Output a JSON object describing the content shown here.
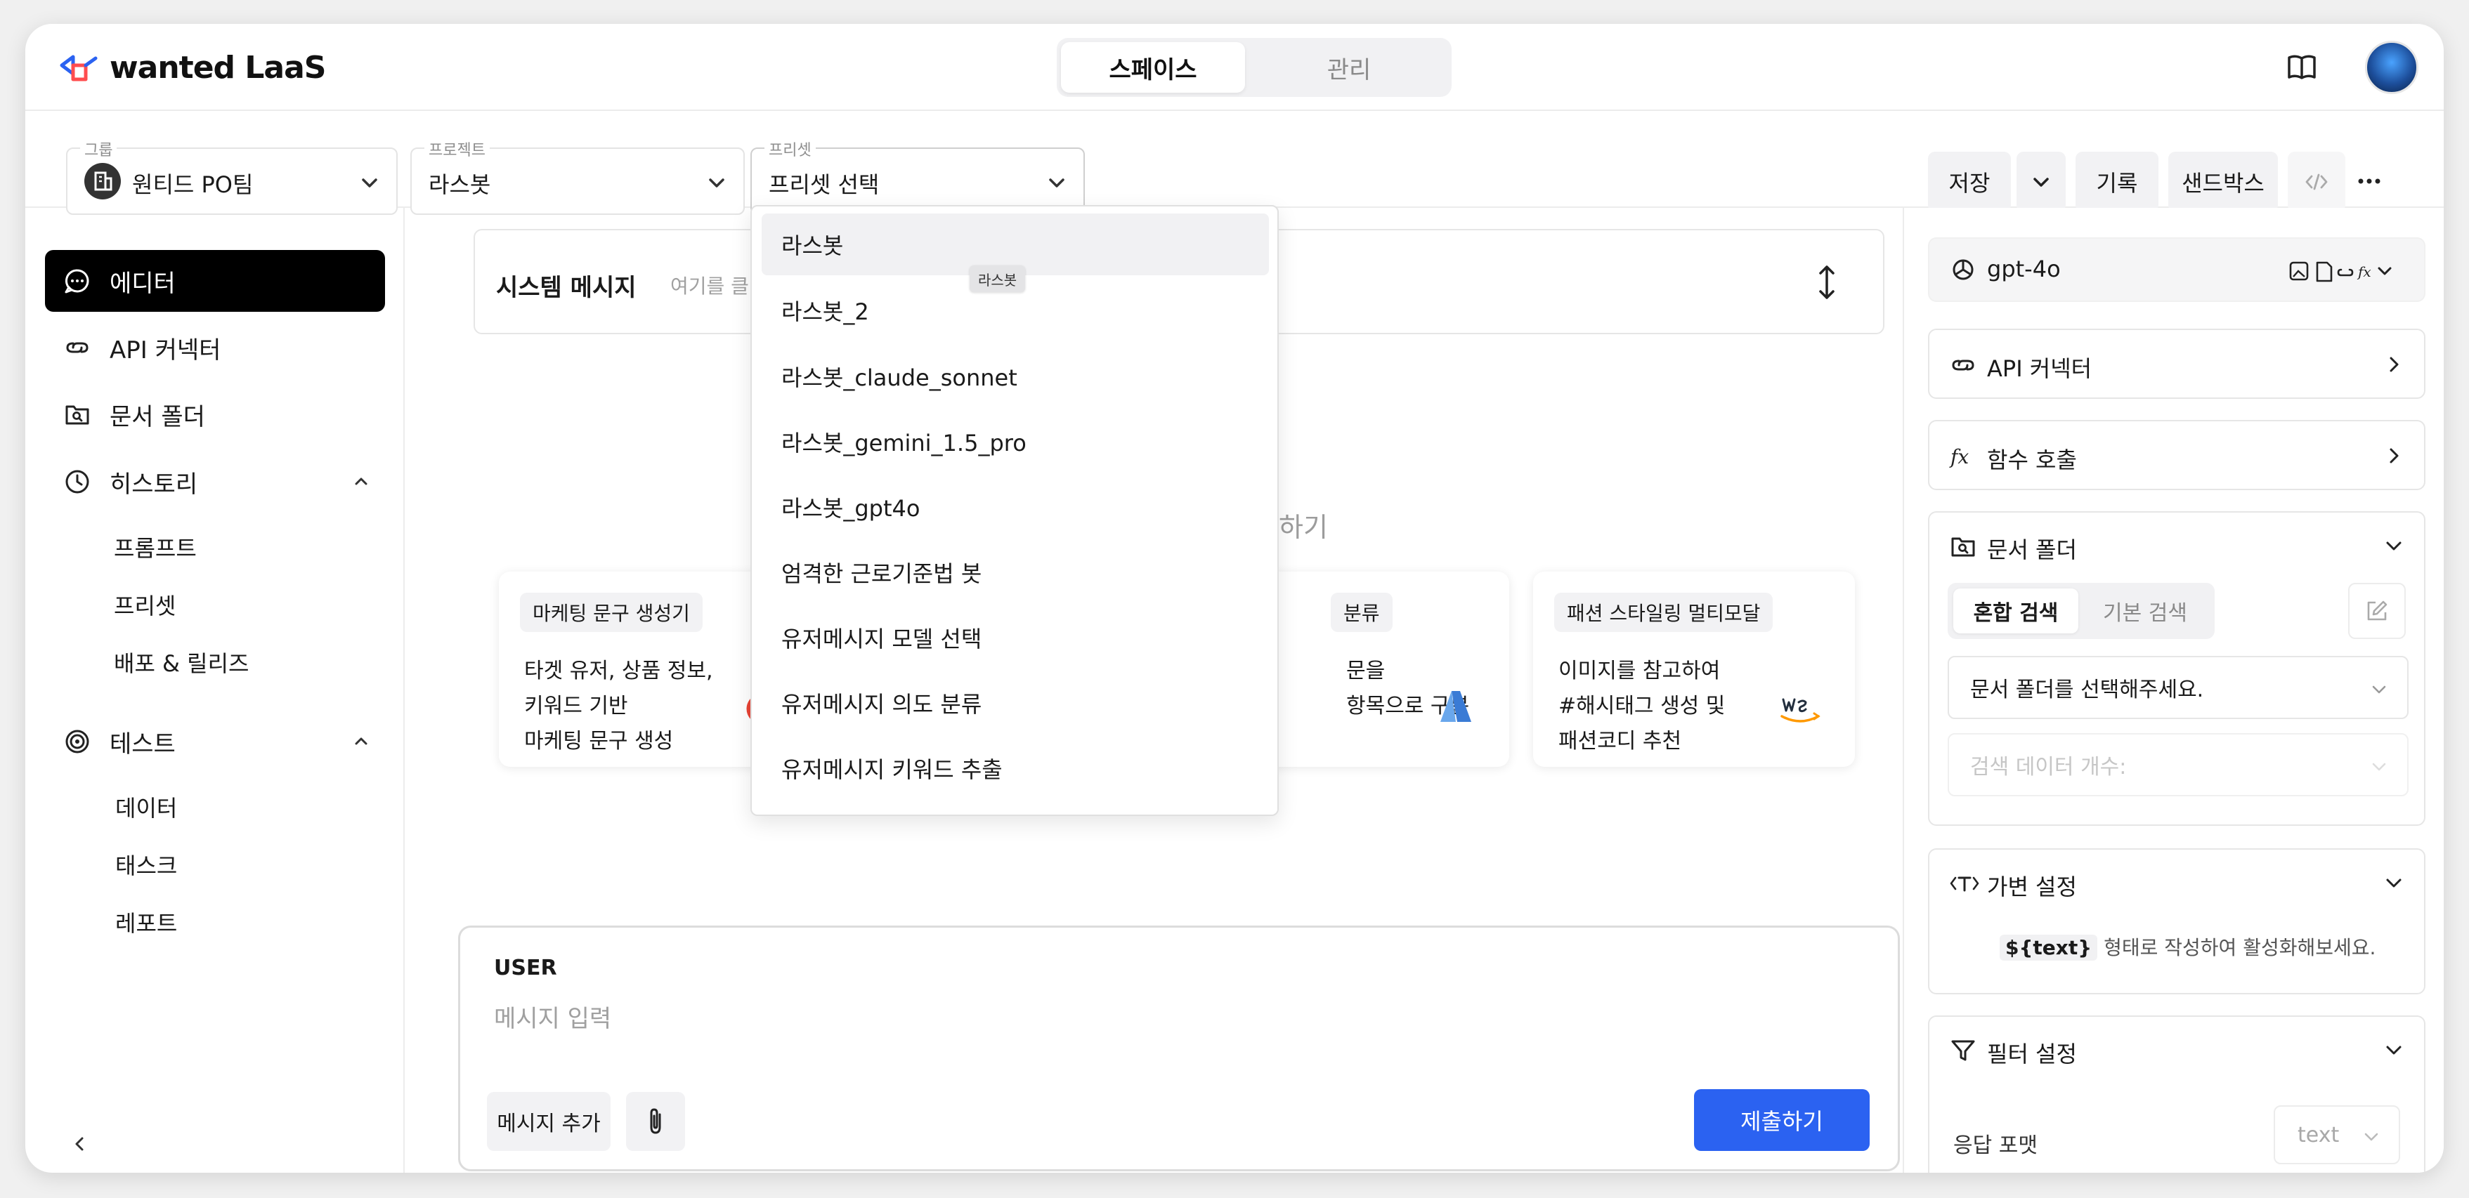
{
  "header": {
    "logo_text": "wanted LaaS",
    "tabs": [
      {
        "label": "스페이스",
        "active": true
      },
      {
        "label": "관리",
        "active": false
      }
    ]
  },
  "toolbar": {
    "group": {
      "label": "그룹",
      "value": "원티드 PO팀"
    },
    "project": {
      "label": "프로젝트",
      "value": "라스봇"
    },
    "preset": {
      "label": "프리셋",
      "value": "프리셋 선택"
    },
    "save_label": "저장",
    "history_label": "기록",
    "sandbox_label": "샌드박스"
  },
  "sidebar": {
    "items": [
      {
        "label": "에디터",
        "icon": "chat-bubble-icon",
        "active": true
      },
      {
        "label": "API 커넥터",
        "icon": "link-icon"
      },
      {
        "label": "문서 폴더",
        "icon": "folder-search-icon"
      },
      {
        "label": "히스토리",
        "icon": "clock-icon",
        "expanded": true
      },
      {
        "label": "테스트",
        "icon": "target-icon",
        "expanded": true
      }
    ],
    "history_sub": [
      "프롬프트",
      "프리셋",
      "배포 & 릴리즈"
    ],
    "test_sub": [
      "데이터",
      "태스크",
      "레포트"
    ]
  },
  "editor": {
    "system_title": "시스템 메시지",
    "system_hint": "여기를 클릭하",
    "center_hint": "하기",
    "cards": [
      {
        "chip": "마케팅 문구 생성기",
        "lines": [
          "타겟 유저, 상품 정보,",
          "키워드 기반",
          "마케팅 문구 생성"
        ]
      },
      {
        "chip": "분류",
        "lines": [
          "문을",
          "항목으로 구분"
        ]
      },
      {
        "chip": "패션 스타일링 멀티모달",
        "lines": [
          "이미지를 참고하여",
          "#해시태그 생성 및",
          "패션코디 추천"
        ]
      }
    ],
    "user_label": "USER",
    "message_placeholder": "메시지 입력",
    "add_message": "메시지 추가",
    "submit": "제출하기"
  },
  "preset_dropdown": {
    "items": [
      "라스봇",
      "라스봇_2",
      "라스봇_claude_sonnet",
      "라스봇_gemini_1.5_pro",
      "라스봇_gpt4o",
      "엄격한 근로기준법 봇",
      "유저메시지 모델 선택",
      "유저메시지 의도 분류",
      "유저메시지 키워드 추출"
    ],
    "hovered_index": 0,
    "tooltip": "라스봇"
  },
  "right_panel": {
    "model": "gpt-4o",
    "api_connector": "API 커넥터",
    "function_call": "함수 호출",
    "doc_folder": {
      "title": "문서 폴더",
      "search_modes": [
        "혼합 검색",
        "기본 검색"
      ],
      "folder_placeholder": "문서 폴더를 선택해주세요.",
      "count_placeholder": "검색 데이터 개수:"
    },
    "variable": {
      "title": "가변 설정",
      "code": "${text}",
      "desc": "형태로 작성하여 활성화해보세요."
    },
    "filter": {
      "title": "필터 설정",
      "response_format_label": "응답 포맷",
      "response_format_value": "text"
    }
  },
  "colors": {
    "accent": "#2b62f1",
    "active_nav_bg": "#000000",
    "logo_blue": "#2b62f1",
    "logo_red": "#ff4d4f"
  }
}
